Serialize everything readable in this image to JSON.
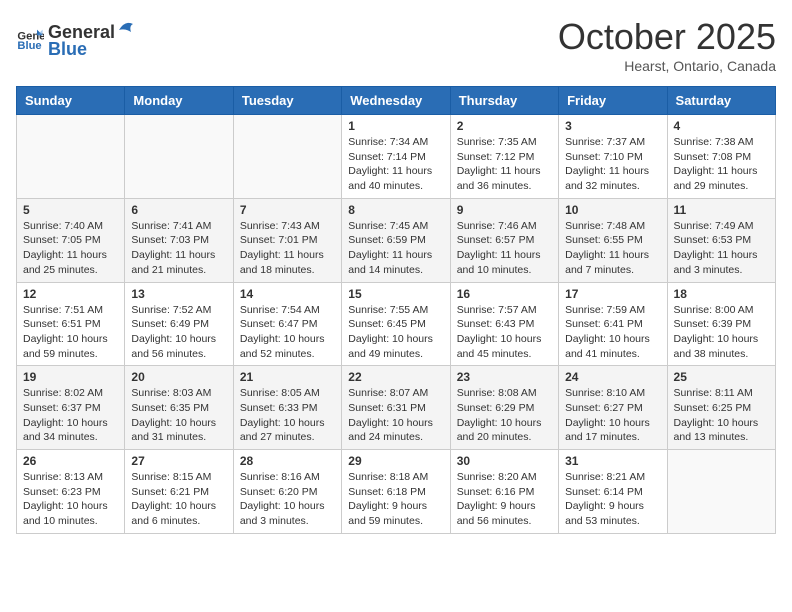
{
  "header": {
    "logo": {
      "general": "General",
      "blue": "Blue"
    },
    "title": "October 2025",
    "subtitle": "Hearst, Ontario, Canada"
  },
  "weekdays": [
    "Sunday",
    "Monday",
    "Tuesday",
    "Wednesday",
    "Thursday",
    "Friday",
    "Saturday"
  ],
  "weeks": [
    [
      {
        "day": "",
        "info": ""
      },
      {
        "day": "",
        "info": ""
      },
      {
        "day": "",
        "info": ""
      },
      {
        "day": "1",
        "sunrise": "7:34 AM",
        "sunset": "7:14 PM",
        "daylight": "11 hours and 40 minutes."
      },
      {
        "day": "2",
        "sunrise": "7:35 AM",
        "sunset": "7:12 PM",
        "daylight": "11 hours and 36 minutes."
      },
      {
        "day": "3",
        "sunrise": "7:37 AM",
        "sunset": "7:10 PM",
        "daylight": "11 hours and 32 minutes."
      },
      {
        "day": "4",
        "sunrise": "7:38 AM",
        "sunset": "7:08 PM",
        "daylight": "11 hours and 29 minutes."
      }
    ],
    [
      {
        "day": "5",
        "sunrise": "7:40 AM",
        "sunset": "7:05 PM",
        "daylight": "11 hours and 25 minutes."
      },
      {
        "day": "6",
        "sunrise": "7:41 AM",
        "sunset": "7:03 PM",
        "daylight": "11 hours and 21 minutes."
      },
      {
        "day": "7",
        "sunrise": "7:43 AM",
        "sunset": "7:01 PM",
        "daylight": "11 hours and 18 minutes."
      },
      {
        "day": "8",
        "sunrise": "7:45 AM",
        "sunset": "6:59 PM",
        "daylight": "11 hours and 14 minutes."
      },
      {
        "day": "9",
        "sunrise": "7:46 AM",
        "sunset": "6:57 PM",
        "daylight": "11 hours and 10 minutes."
      },
      {
        "day": "10",
        "sunrise": "7:48 AM",
        "sunset": "6:55 PM",
        "daylight": "11 hours and 7 minutes."
      },
      {
        "day": "11",
        "sunrise": "7:49 AM",
        "sunset": "6:53 PM",
        "daylight": "11 hours and 3 minutes."
      }
    ],
    [
      {
        "day": "12",
        "sunrise": "7:51 AM",
        "sunset": "6:51 PM",
        "daylight": "10 hours and 59 minutes."
      },
      {
        "day": "13",
        "sunrise": "7:52 AM",
        "sunset": "6:49 PM",
        "daylight": "10 hours and 56 minutes."
      },
      {
        "day": "14",
        "sunrise": "7:54 AM",
        "sunset": "6:47 PM",
        "daylight": "10 hours and 52 minutes."
      },
      {
        "day": "15",
        "sunrise": "7:55 AM",
        "sunset": "6:45 PM",
        "daylight": "10 hours and 49 minutes."
      },
      {
        "day": "16",
        "sunrise": "7:57 AM",
        "sunset": "6:43 PM",
        "daylight": "10 hours and 45 minutes."
      },
      {
        "day": "17",
        "sunrise": "7:59 AM",
        "sunset": "6:41 PM",
        "daylight": "10 hours and 41 minutes."
      },
      {
        "day": "18",
        "sunrise": "8:00 AM",
        "sunset": "6:39 PM",
        "daylight": "10 hours and 38 minutes."
      }
    ],
    [
      {
        "day": "19",
        "sunrise": "8:02 AM",
        "sunset": "6:37 PM",
        "daylight": "10 hours and 34 minutes."
      },
      {
        "day": "20",
        "sunrise": "8:03 AM",
        "sunset": "6:35 PM",
        "daylight": "10 hours and 31 minutes."
      },
      {
        "day": "21",
        "sunrise": "8:05 AM",
        "sunset": "6:33 PM",
        "daylight": "10 hours and 27 minutes."
      },
      {
        "day": "22",
        "sunrise": "8:07 AM",
        "sunset": "6:31 PM",
        "daylight": "10 hours and 24 minutes."
      },
      {
        "day": "23",
        "sunrise": "8:08 AM",
        "sunset": "6:29 PM",
        "daylight": "10 hours and 20 minutes."
      },
      {
        "day": "24",
        "sunrise": "8:10 AM",
        "sunset": "6:27 PM",
        "daylight": "10 hours and 17 minutes."
      },
      {
        "day": "25",
        "sunrise": "8:11 AM",
        "sunset": "6:25 PM",
        "daylight": "10 hours and 13 minutes."
      }
    ],
    [
      {
        "day": "26",
        "sunrise": "8:13 AM",
        "sunset": "6:23 PM",
        "daylight": "10 hours and 10 minutes."
      },
      {
        "day": "27",
        "sunrise": "8:15 AM",
        "sunset": "6:21 PM",
        "daylight": "10 hours and 6 minutes."
      },
      {
        "day": "28",
        "sunrise": "8:16 AM",
        "sunset": "6:20 PM",
        "daylight": "10 hours and 3 minutes."
      },
      {
        "day": "29",
        "sunrise": "8:18 AM",
        "sunset": "6:18 PM",
        "daylight": "9 hours and 59 minutes."
      },
      {
        "day": "30",
        "sunrise": "8:20 AM",
        "sunset": "6:16 PM",
        "daylight": "9 hours and 56 minutes."
      },
      {
        "day": "31",
        "sunrise": "8:21 AM",
        "sunset": "6:14 PM",
        "daylight": "9 hours and 53 minutes."
      },
      {
        "day": "",
        "info": ""
      }
    ]
  ]
}
